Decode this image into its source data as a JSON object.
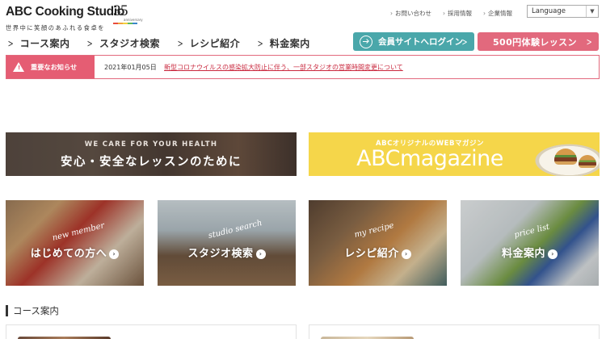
{
  "header": {
    "logo_text": "ABC Cooking Studio",
    "logo_anniversary": "35",
    "logo_anniversary_sub": "anniversary",
    "tagline": "世界中に笑顔のあふれる食卓を",
    "util_links": [
      "お問い合わせ",
      "採用情報",
      "企業情報"
    ],
    "language_label": "Language"
  },
  "nav": {
    "items": [
      "コース案内",
      "スタジオ検索",
      "レシピ紹介",
      "料金案内"
    ],
    "member_button": "会員サイトへログイン",
    "trial_button": "500円体験レッスン"
  },
  "notice": {
    "label": "重要なお知らせ",
    "date": "2021年01月05日",
    "link_text": "新型コロナウイルスの感染拡大防止に伴う、一部スタジオの営業時間変更について"
  },
  "banners": {
    "safety": {
      "sub": "WE CARE FOR YOUR HEALTH",
      "main": "安心・安全なレッスンのために"
    },
    "magazine": {
      "sub": "ABCオリジナルのWEBマガジン",
      "main": "ABCmagazine"
    }
  },
  "tiles": [
    {
      "script": "new member",
      "label": "はじめての方へ"
    },
    {
      "script": "studio search",
      "label": "スタジオ検索"
    },
    {
      "script": "my recipe",
      "label": "レシピ紹介"
    },
    {
      "script": "price list",
      "label": "料金案内"
    }
  ],
  "section": {
    "title": "コース案内"
  },
  "colors": {
    "teal": "#4aa7aa",
    "pink": "#e2697d",
    "notice_red": "#c9283e",
    "magazine_yellow": "#f5d64a"
  }
}
